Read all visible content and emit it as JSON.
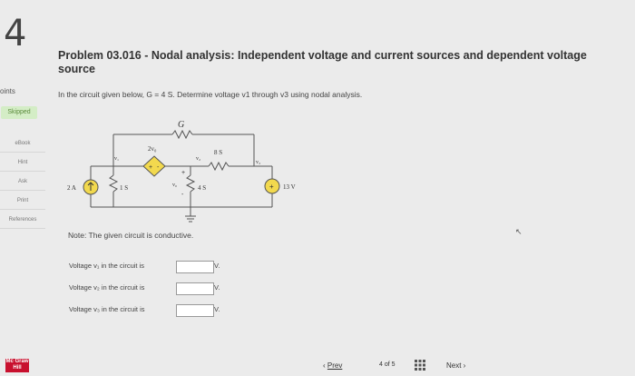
{
  "question_number": "4",
  "points_label": "oints",
  "status_badge": "Skipped",
  "sidebar": {
    "items": [
      {
        "label": "eBook"
      },
      {
        "label": "Hint"
      },
      {
        "label": "Ask"
      },
      {
        "label": "Print"
      },
      {
        "label": "References"
      }
    ]
  },
  "problem": {
    "title": "Problem 03.016 - Nodal analysis: Independent voltage and current sources and dependent voltage source",
    "instruction": "In the circuit given below, G = 4 S. Determine voltage v1 through v3 using nodal analysis.",
    "note": "Note: The given circuit is conductive."
  },
  "circuit": {
    "g_label": "G",
    "dep_source_label": "2v₀",
    "v1_label": "v₁",
    "v2_label": "v₂",
    "v3_label": "v₃",
    "r_top_label": "8 S",
    "current_source_label": "2 A",
    "r1_label": "1 S",
    "r2_label": "4 S",
    "vo_label": "v₀",
    "voltage_source_label": "13 V"
  },
  "answers": [
    {
      "label": "Voltage v₁ in the circuit is",
      "value": "",
      "unit": "V."
    },
    {
      "label": "Voltage v₂ in the circuit is",
      "value": "",
      "unit": "V."
    },
    {
      "label": "Voltage v₃ in the circuit is",
      "value": "",
      "unit": "V."
    }
  ],
  "footer": {
    "logo": "Mc Graw Hill",
    "prev_label": "Prev",
    "page_current": "4",
    "page_of": "of",
    "page_total": "5",
    "next_label": "Next"
  }
}
